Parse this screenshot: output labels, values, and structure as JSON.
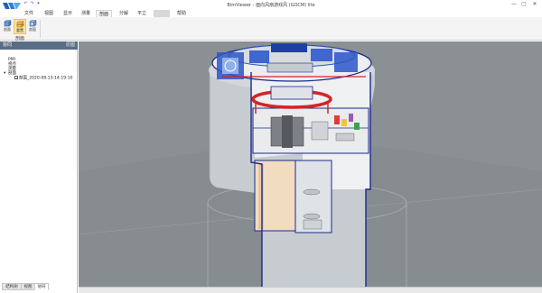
{
  "window": {
    "title": "BimViewer - 面向风扇游戏风 (GOCM) lite",
    "minimize": "—",
    "maximize": "▢",
    "close": "✕"
  },
  "quick_access": [
    "↶",
    "↷",
    "▾"
  ],
  "tabs": [
    {
      "label": "文件",
      "active": false,
      "blurred": false
    },
    {
      "label": "视图",
      "active": false,
      "blurred": false
    },
    {
      "label": "显示",
      "active": false,
      "blurred": false
    },
    {
      "label": "测量",
      "active": false,
      "blurred": false
    },
    {
      "label": "剖面",
      "active": true,
      "blurred": false
    },
    {
      "label": "分解",
      "active": false,
      "blurred": false
    },
    {
      "label": "平立",
      "active": false,
      "blurred": false
    },
    {
      "label": "",
      "active": false,
      "blurred": true
    },
    {
      "label": "帮助",
      "active": false,
      "blurred": false
    }
  ],
  "ribbon": {
    "buttons": [
      {
        "label": "剖面",
        "icon": "section-box-icon",
        "selected": false
      },
      {
        "label": "重置",
        "icon": "reset-section-icon",
        "selected": true
      },
      {
        "label": "剖面",
        "icon": "section-plane-icon",
        "selected": false
      }
    ],
    "group_label": "剖面"
  },
  "panel": {
    "title": "协同",
    "tool": "原图",
    "tree": [
      {
        "label": "PMI",
        "indent": 0,
        "expander": "",
        "checked": null
      },
      {
        "label": "视点",
        "indent": 0,
        "expander": "",
        "checked": null
      },
      {
        "label": "测量",
        "indent": 0,
        "expander": "",
        "checked": null
      },
      {
        "label": "剖面",
        "indent": 0,
        "expander": "▾",
        "checked": null
      },
      {
        "label": "剖面_2020-08-13-14-19-10",
        "indent": 1,
        "expander": "",
        "checked": true
      }
    ],
    "bottom_tabs": [
      {
        "label": "结构树",
        "active": false
      },
      {
        "label": "视图",
        "active": false
      },
      {
        "label": "协同",
        "active": true
      }
    ]
  },
  "colors": {
    "viewport_bg": "#8a9094",
    "panel_header": "#5a6d86",
    "accent_blue": "#2b55c9",
    "accent_red": "#d12626",
    "selected_button": "#fbe49a"
  }
}
